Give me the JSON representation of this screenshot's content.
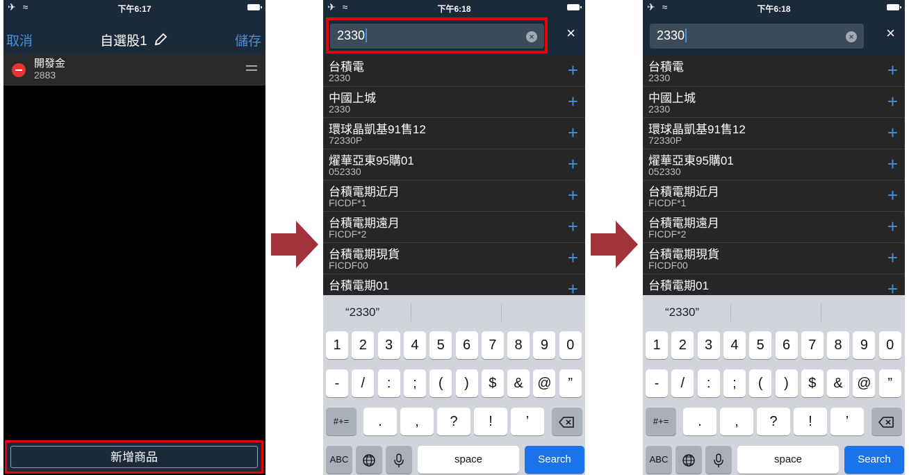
{
  "status": {
    "left": "✈ ≈",
    "time1": "下午6:17",
    "time2": "下午6:18",
    "time3": "下午6:18"
  },
  "screen1": {
    "cancel": "取消",
    "title": "自選股1",
    "save": "儲存",
    "item": {
      "name": "開發金",
      "code": "2883"
    },
    "add_button": "新增商品"
  },
  "search": {
    "query": "2330",
    "clear": "×",
    "close": "×"
  },
  "results": [
    {
      "name": "台積電",
      "code": "2330"
    },
    {
      "name": "中國上城",
      "code": "2330"
    },
    {
      "name": "環球晶凱基91售12",
      "code": "72330P"
    },
    {
      "name": "燿華亞東95購01",
      "code": "052330"
    },
    {
      "name": "台積電期近月",
      "code": "FICDF*1"
    },
    {
      "name": "台積電期遠月",
      "code": "FICDF*2"
    },
    {
      "name": "台積電期現貨",
      "code": "FICDF00"
    },
    {
      "name": "台積電期01",
      "code": ""
    }
  ],
  "keyboard": {
    "suggestion": "“2330”",
    "row1": [
      "1",
      "2",
      "3",
      "4",
      "5",
      "6",
      "7",
      "8",
      "9",
      "0"
    ],
    "row2": [
      "-",
      "/",
      ":",
      ";",
      "(",
      ")",
      "$",
      "&",
      "@",
      "”"
    ],
    "row3_left": "#+=",
    "row3": [
      ".",
      ",",
      "?",
      "!",
      "’"
    ],
    "abc": "ABC",
    "space": "space",
    "search": "Search"
  },
  "colors": {
    "accent": "#4a90d9",
    "highlight": "#e00000",
    "navbar": "#1b2a3b",
    "arrow": "#a3333a"
  }
}
